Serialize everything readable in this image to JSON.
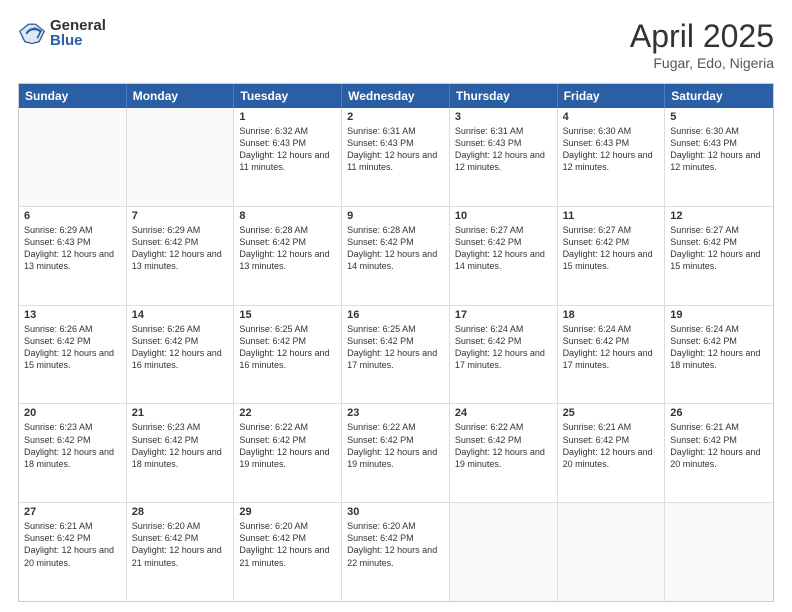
{
  "logo": {
    "general": "General",
    "blue": "Blue"
  },
  "title": "April 2025",
  "location": "Fugar, Edo, Nigeria",
  "days": [
    "Sunday",
    "Monday",
    "Tuesday",
    "Wednesday",
    "Thursday",
    "Friday",
    "Saturday"
  ],
  "rows": [
    [
      {
        "day": "",
        "empty": true
      },
      {
        "day": "",
        "empty": true
      },
      {
        "day": "1",
        "sunrise": "Sunrise: 6:32 AM",
        "sunset": "Sunset: 6:43 PM",
        "daylight": "Daylight: 12 hours and 11 minutes."
      },
      {
        "day": "2",
        "sunrise": "Sunrise: 6:31 AM",
        "sunset": "Sunset: 6:43 PM",
        "daylight": "Daylight: 12 hours and 11 minutes."
      },
      {
        "day": "3",
        "sunrise": "Sunrise: 6:31 AM",
        "sunset": "Sunset: 6:43 PM",
        "daylight": "Daylight: 12 hours and 12 minutes."
      },
      {
        "day": "4",
        "sunrise": "Sunrise: 6:30 AM",
        "sunset": "Sunset: 6:43 PM",
        "daylight": "Daylight: 12 hours and 12 minutes."
      },
      {
        "day": "5",
        "sunrise": "Sunrise: 6:30 AM",
        "sunset": "Sunset: 6:43 PM",
        "daylight": "Daylight: 12 hours and 12 minutes."
      }
    ],
    [
      {
        "day": "6",
        "sunrise": "Sunrise: 6:29 AM",
        "sunset": "Sunset: 6:43 PM",
        "daylight": "Daylight: 12 hours and 13 minutes."
      },
      {
        "day": "7",
        "sunrise": "Sunrise: 6:29 AM",
        "sunset": "Sunset: 6:42 PM",
        "daylight": "Daylight: 12 hours and 13 minutes."
      },
      {
        "day": "8",
        "sunrise": "Sunrise: 6:28 AM",
        "sunset": "Sunset: 6:42 PM",
        "daylight": "Daylight: 12 hours and 13 minutes."
      },
      {
        "day": "9",
        "sunrise": "Sunrise: 6:28 AM",
        "sunset": "Sunset: 6:42 PM",
        "daylight": "Daylight: 12 hours and 14 minutes."
      },
      {
        "day": "10",
        "sunrise": "Sunrise: 6:27 AM",
        "sunset": "Sunset: 6:42 PM",
        "daylight": "Daylight: 12 hours and 14 minutes."
      },
      {
        "day": "11",
        "sunrise": "Sunrise: 6:27 AM",
        "sunset": "Sunset: 6:42 PM",
        "daylight": "Daylight: 12 hours and 15 minutes."
      },
      {
        "day": "12",
        "sunrise": "Sunrise: 6:27 AM",
        "sunset": "Sunset: 6:42 PM",
        "daylight": "Daylight: 12 hours and 15 minutes."
      }
    ],
    [
      {
        "day": "13",
        "sunrise": "Sunrise: 6:26 AM",
        "sunset": "Sunset: 6:42 PM",
        "daylight": "Daylight: 12 hours and 15 minutes."
      },
      {
        "day": "14",
        "sunrise": "Sunrise: 6:26 AM",
        "sunset": "Sunset: 6:42 PM",
        "daylight": "Daylight: 12 hours and 16 minutes."
      },
      {
        "day": "15",
        "sunrise": "Sunrise: 6:25 AM",
        "sunset": "Sunset: 6:42 PM",
        "daylight": "Daylight: 12 hours and 16 minutes."
      },
      {
        "day": "16",
        "sunrise": "Sunrise: 6:25 AM",
        "sunset": "Sunset: 6:42 PM",
        "daylight": "Daylight: 12 hours and 17 minutes."
      },
      {
        "day": "17",
        "sunrise": "Sunrise: 6:24 AM",
        "sunset": "Sunset: 6:42 PM",
        "daylight": "Daylight: 12 hours and 17 minutes."
      },
      {
        "day": "18",
        "sunrise": "Sunrise: 6:24 AM",
        "sunset": "Sunset: 6:42 PM",
        "daylight": "Daylight: 12 hours and 17 minutes."
      },
      {
        "day": "19",
        "sunrise": "Sunrise: 6:24 AM",
        "sunset": "Sunset: 6:42 PM",
        "daylight": "Daylight: 12 hours and 18 minutes."
      }
    ],
    [
      {
        "day": "20",
        "sunrise": "Sunrise: 6:23 AM",
        "sunset": "Sunset: 6:42 PM",
        "daylight": "Daylight: 12 hours and 18 minutes."
      },
      {
        "day": "21",
        "sunrise": "Sunrise: 6:23 AM",
        "sunset": "Sunset: 6:42 PM",
        "daylight": "Daylight: 12 hours and 18 minutes."
      },
      {
        "day": "22",
        "sunrise": "Sunrise: 6:22 AM",
        "sunset": "Sunset: 6:42 PM",
        "daylight": "Daylight: 12 hours and 19 minutes."
      },
      {
        "day": "23",
        "sunrise": "Sunrise: 6:22 AM",
        "sunset": "Sunset: 6:42 PM",
        "daylight": "Daylight: 12 hours and 19 minutes."
      },
      {
        "day": "24",
        "sunrise": "Sunrise: 6:22 AM",
        "sunset": "Sunset: 6:42 PM",
        "daylight": "Daylight: 12 hours and 19 minutes."
      },
      {
        "day": "25",
        "sunrise": "Sunrise: 6:21 AM",
        "sunset": "Sunset: 6:42 PM",
        "daylight": "Daylight: 12 hours and 20 minutes."
      },
      {
        "day": "26",
        "sunrise": "Sunrise: 6:21 AM",
        "sunset": "Sunset: 6:42 PM",
        "daylight": "Daylight: 12 hours and 20 minutes."
      }
    ],
    [
      {
        "day": "27",
        "sunrise": "Sunrise: 6:21 AM",
        "sunset": "Sunset: 6:42 PM",
        "daylight": "Daylight: 12 hours and 20 minutes."
      },
      {
        "day": "28",
        "sunrise": "Sunrise: 6:20 AM",
        "sunset": "Sunset: 6:42 PM",
        "daylight": "Daylight: 12 hours and 21 minutes."
      },
      {
        "day": "29",
        "sunrise": "Sunrise: 6:20 AM",
        "sunset": "Sunset: 6:42 PM",
        "daylight": "Daylight: 12 hours and 21 minutes."
      },
      {
        "day": "30",
        "sunrise": "Sunrise: 6:20 AM",
        "sunset": "Sunset: 6:42 PM",
        "daylight": "Daylight: 12 hours and 22 minutes."
      },
      {
        "day": "",
        "empty": true
      },
      {
        "day": "",
        "empty": true
      },
      {
        "day": "",
        "empty": true
      }
    ]
  ]
}
